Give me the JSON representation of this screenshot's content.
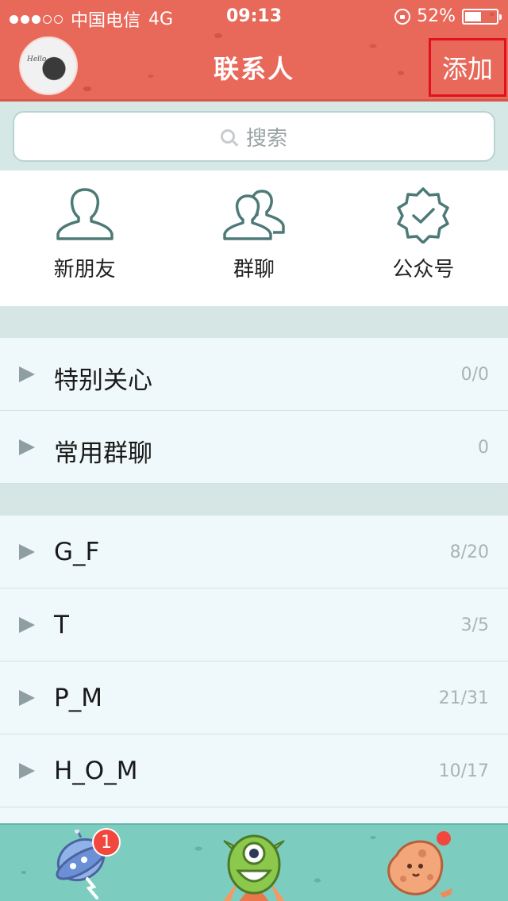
{
  "status_bar": {
    "carrier": "中国电信",
    "network": "4G",
    "time": "09:13",
    "battery": "52%",
    "battery_level": 0.52,
    "signal_bars_filled": 3,
    "signal_bars_total": 5
  },
  "header": {
    "title": "联系人",
    "add_label": "添加",
    "avatar_text": "Hello"
  },
  "search": {
    "placeholder": "搜索"
  },
  "shortcuts": [
    {
      "label": "新朋友",
      "icon": "person-icon"
    },
    {
      "label": "群聊",
      "icon": "group-icon"
    },
    {
      "label": "公众号",
      "icon": "verified-badge-icon"
    }
  ],
  "groups_top": [
    {
      "name": "特别关心",
      "count": "0/0"
    },
    {
      "name": "常用群聊",
      "count": "0"
    }
  ],
  "groups_main": [
    {
      "name": "G_F",
      "count": "8/20"
    },
    {
      "name": "T",
      "count": "3/5"
    },
    {
      "name": "P_M",
      "count": "21/31"
    },
    {
      "name": "H_O_M",
      "count": "10/17"
    }
  ],
  "tabbar": {
    "messages_badge": "1",
    "messages_icon": "ufo-icon",
    "contacts_icon": "monster-icon",
    "dynamic_icon": "planet-icon"
  },
  "colors": {
    "header": "#e8685a",
    "tabbar": "#7ccdc0",
    "badge": "#f2473d",
    "highlight_border": "#e0121b"
  }
}
